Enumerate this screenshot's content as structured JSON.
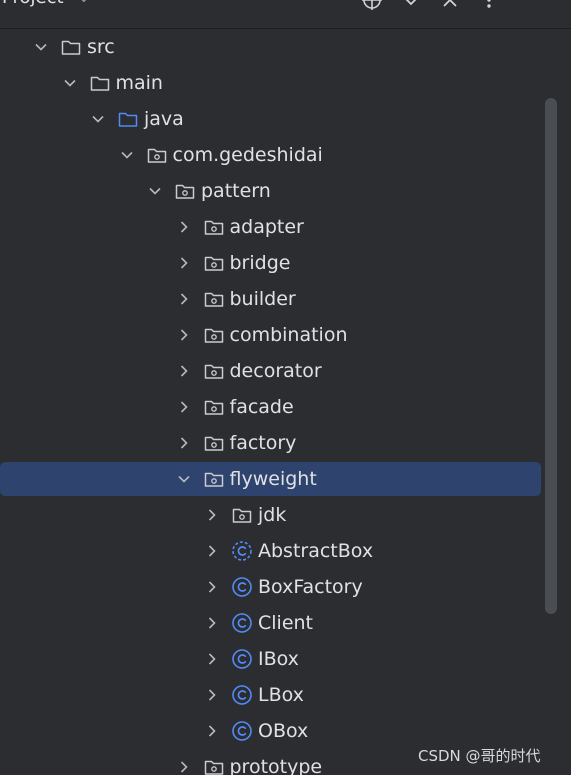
{
  "panel": {
    "title": "Project",
    "caret": "⌄"
  },
  "header_buttons": [
    {
      "name": "locate-icon"
    },
    {
      "name": "expand-icon"
    },
    {
      "name": "close-icon"
    },
    {
      "name": "more-icon"
    }
  ],
  "tree": [
    {
      "label": "src",
      "depth": 0,
      "expanded": true,
      "icon": "folder-icon"
    },
    {
      "label": "main",
      "depth": 1,
      "expanded": true,
      "icon": "folder-icon"
    },
    {
      "label": "java",
      "depth": 2,
      "expanded": true,
      "icon": "source-folder-icon"
    },
    {
      "label": "com.gedeshidai",
      "depth": 3,
      "expanded": true,
      "icon": "package-icon"
    },
    {
      "label": "pattern",
      "depth": 4,
      "expanded": true,
      "icon": "package-icon"
    },
    {
      "label": "adapter",
      "depth": 5,
      "expanded": false,
      "icon": "package-icon"
    },
    {
      "label": "bridge",
      "depth": 5,
      "expanded": false,
      "icon": "package-icon"
    },
    {
      "label": "builder",
      "depth": 5,
      "expanded": false,
      "icon": "package-icon"
    },
    {
      "label": "combination",
      "depth": 5,
      "expanded": false,
      "icon": "package-icon"
    },
    {
      "label": "decorator",
      "depth": 5,
      "expanded": false,
      "icon": "package-icon"
    },
    {
      "label": "facade",
      "depth": 5,
      "expanded": false,
      "icon": "package-icon"
    },
    {
      "label": "factory",
      "depth": 5,
      "expanded": false,
      "icon": "package-icon"
    },
    {
      "label": "flyweight",
      "depth": 5,
      "expanded": true,
      "icon": "package-icon",
      "selected": true
    },
    {
      "label": "jdk",
      "depth": 6,
      "expanded": false,
      "icon": "package-icon"
    },
    {
      "label": "AbstractBox",
      "depth": 6,
      "expanded": false,
      "icon": "abstract-class-icon"
    },
    {
      "label": "BoxFactory",
      "depth": 6,
      "expanded": false,
      "icon": "class-icon"
    },
    {
      "label": "Client",
      "depth": 6,
      "expanded": false,
      "icon": "class-icon"
    },
    {
      "label": "IBox",
      "depth": 6,
      "expanded": false,
      "icon": "class-icon"
    },
    {
      "label": "LBox",
      "depth": 6,
      "expanded": false,
      "icon": "class-icon"
    },
    {
      "label": "OBox",
      "depth": 6,
      "expanded": false,
      "icon": "class-icon"
    },
    {
      "label": "prototype",
      "depth": 5,
      "expanded": false,
      "icon": "package-icon"
    }
  ],
  "colors": {
    "background": "#2b2d30",
    "selection": "#2e436e",
    "text": "#dfe1e5",
    "class_icon": "#548af7",
    "source_folder": "#548af7"
  },
  "watermark": "CSDN @哥的时代"
}
